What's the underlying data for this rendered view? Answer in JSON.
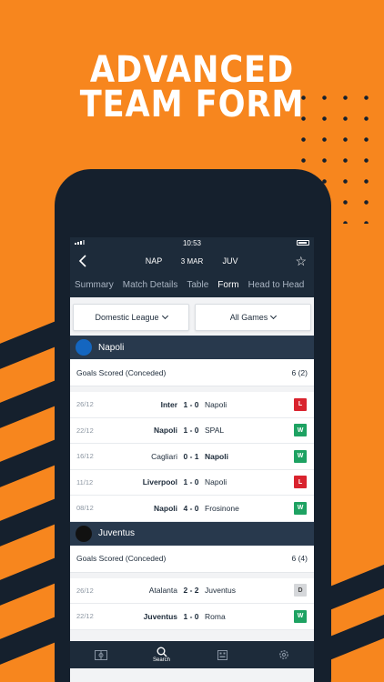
{
  "promo": {
    "title_line1": "ADVANCED",
    "title_line2": "TEAM FORM"
  },
  "status_bar": {
    "time": "10:53"
  },
  "match_header": {
    "home_code": "NAP",
    "date": "3 MAR",
    "away_code": "JUV"
  },
  "tabs": [
    {
      "label": "Summary",
      "active": false
    },
    {
      "label": "Match Details",
      "active": false
    },
    {
      "label": "Table",
      "active": false
    },
    {
      "label": "Form",
      "active": true
    },
    {
      "label": "Head to Head",
      "active": false
    }
  ],
  "filters": {
    "competition": "Domestic League",
    "games": "All Games"
  },
  "teams": [
    {
      "name": "Napoli",
      "crest_color": "#1466c0",
      "summary_label": "Goals Scored (Conceded)",
      "summary_value": "6 (2)",
      "matches": [
        {
          "date": "26/12",
          "home": "Inter",
          "score": "1 - 0",
          "away": "Napoli",
          "result": "L",
          "home_bold": true
        },
        {
          "date": "22/12",
          "home": "Napoli",
          "score": "1 - 0",
          "away": "SPAL",
          "result": "W",
          "home_bold": true
        },
        {
          "date": "16/12",
          "home": "Cagliari",
          "score": "0 - 1",
          "away": "Napoli",
          "result": "W",
          "home_bold": false
        },
        {
          "date": "11/12",
          "home": "Liverpool",
          "score": "1 - 0",
          "away": "Napoli",
          "result": "L",
          "home_bold": true
        },
        {
          "date": "08/12",
          "home": "Napoli",
          "score": "4 - 0",
          "away": "Frosinone",
          "result": "W",
          "home_bold": true
        }
      ]
    },
    {
      "name": "Juventus",
      "crest_color": "#111111",
      "summary_label": "Goals Scored (Conceded)",
      "summary_value": "6 (4)",
      "matches": [
        {
          "date": "26/12",
          "home": "Atalanta",
          "score": "2 - 2",
          "away": "Juventus",
          "result": "D",
          "home_bold": false
        },
        {
          "date": "22/12",
          "home": "Juventus",
          "score": "1 - 0",
          "away": "Roma",
          "result": "W",
          "home_bold": true
        }
      ]
    }
  ],
  "bottom_nav": [
    {
      "icon": "pitch-icon",
      "label": "",
      "active": false
    },
    {
      "icon": "search-icon",
      "label": "Search",
      "active": true
    },
    {
      "icon": "scores-icon",
      "label": "",
      "active": false
    },
    {
      "icon": "gear-icon",
      "label": "",
      "active": false
    }
  ],
  "colors": {
    "orange": "#f7861e",
    "navy": "#1d2b3a",
    "win": "#1ea262",
    "loss": "#d9232e",
    "draw": "#d5d7da"
  }
}
